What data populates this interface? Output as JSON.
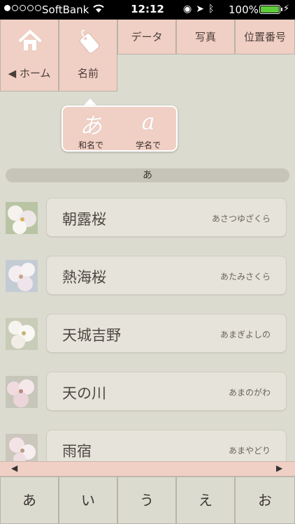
{
  "status_bar": {
    "carrier": "SoftBank",
    "time": "12:12",
    "battery_percent": "100%",
    "signal_dots": [
      true,
      false,
      false,
      false,
      false
    ],
    "icons": [
      "orientation-lock-icon",
      "location-icon",
      "bluetooth-icon"
    ],
    "battery_color": "#5ecb3a"
  },
  "nav": {
    "home_label": "◀ ホーム",
    "name_label": "名前",
    "data_label": "データ",
    "photo_label": "写真",
    "position_label": "位置番号"
  },
  "popup": {
    "japanese": {
      "glyph": "あ",
      "label": "和名で"
    },
    "scientific": {
      "glyph": "a",
      "label": "学名で"
    }
  },
  "section_header": "あ",
  "items": [
    {
      "name": "朝露桜",
      "reading": "あさつゆざくら"
    },
    {
      "name": "熱海桜",
      "reading": "あたみさくら"
    },
    {
      "name": "天城吉野",
      "reading": "あまぎよしの"
    },
    {
      "name": "天の川",
      "reading": "あまのがわ"
    },
    {
      "name": "雨宿",
      "reading": "あまやどり"
    }
  ],
  "scroll": {
    "left": "◀",
    "right": "▶"
  },
  "index_tabs": [
    "あ",
    "い",
    "う",
    "え",
    "お"
  ],
  "colors": {
    "accent_pink": "#f0cfc5",
    "background": "#dcdbd0"
  }
}
